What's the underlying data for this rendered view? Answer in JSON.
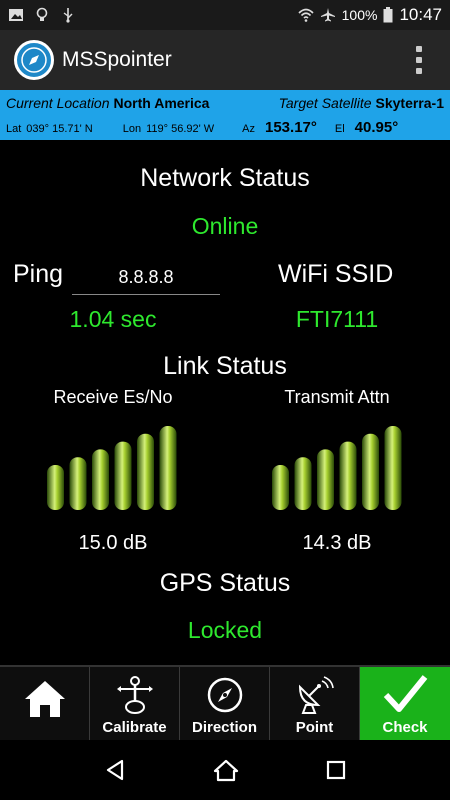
{
  "status_bar": {
    "battery": "100%",
    "time": "10:47"
  },
  "app": {
    "title": "MSSpointer"
  },
  "info": {
    "current_location_label": "Current Location",
    "current_location_value": "North America",
    "target_satellite_label": "Target Satellite",
    "target_satellite_value": "Skyterra-1",
    "lat_label": "Lat",
    "lat_value": "039° 15.71' N",
    "lon_label": "Lon",
    "lon_value": "119° 56.92' W",
    "az_label": "Az",
    "az_value": "153.17°",
    "el_label": "El",
    "el_value": "40.95°"
  },
  "network": {
    "heading": "Network Status",
    "status": "Online",
    "ping_label": "Ping",
    "ping_host": "8.8.8.8",
    "ping_result": "1.04 sec",
    "wifi_label": "WiFi SSID",
    "wifi_value": "FTI7111"
  },
  "link": {
    "heading": "Link Status",
    "receive_label": "Receive Es/No",
    "receive_value": "15.0 dB",
    "receive_bars_lit": 6,
    "transmit_label": "Transmit Attn",
    "transmit_value": "14.3 dB",
    "transmit_bars_lit": 6,
    "total_bars": 6
  },
  "gps": {
    "heading": "GPS Status",
    "status": "Locked"
  },
  "bottom_nav": {
    "items": [
      {
        "label": "",
        "icon": "home-icon"
      },
      {
        "label": "Calibrate",
        "icon": "calibrate-icon"
      },
      {
        "label": "Direction",
        "icon": "compass-icon"
      },
      {
        "label": "Point",
        "icon": "satellite-dish-icon"
      },
      {
        "label": "Check",
        "icon": "checkmark-icon"
      }
    ]
  },
  "colors": {
    "accent_blue": "#1fa3e8",
    "status_green": "#2ee82e",
    "active_green": "#1ab21a"
  }
}
